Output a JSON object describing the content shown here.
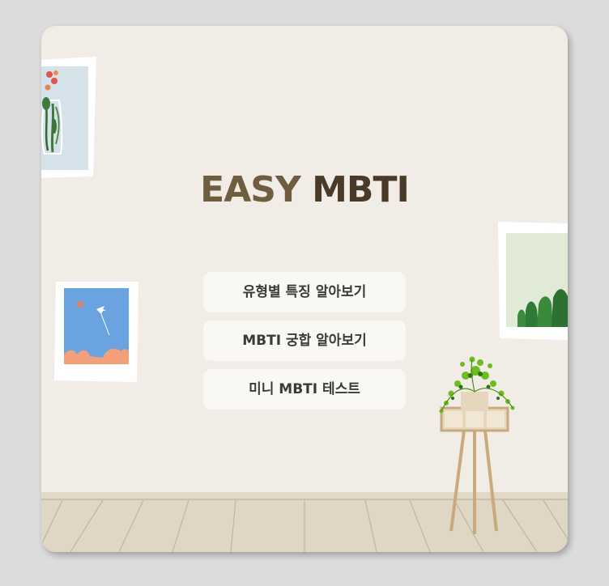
{
  "title": {
    "part1": "EASY",
    "part2": "MBTI"
  },
  "menu": [
    {
      "label": "유형별 특징 알아보기"
    },
    {
      "label": "MBTI 궁합 알아보기"
    },
    {
      "label": "미니 MBTI 테스트"
    }
  ],
  "colors": {
    "card_bg": "#f1ede6",
    "page_bg": "#dcdcdc",
    "title_light": "#6f5d3f",
    "title_dark": "#4a3a28",
    "button_bg": "#faf8f4",
    "floor": "#e0d6c4"
  }
}
